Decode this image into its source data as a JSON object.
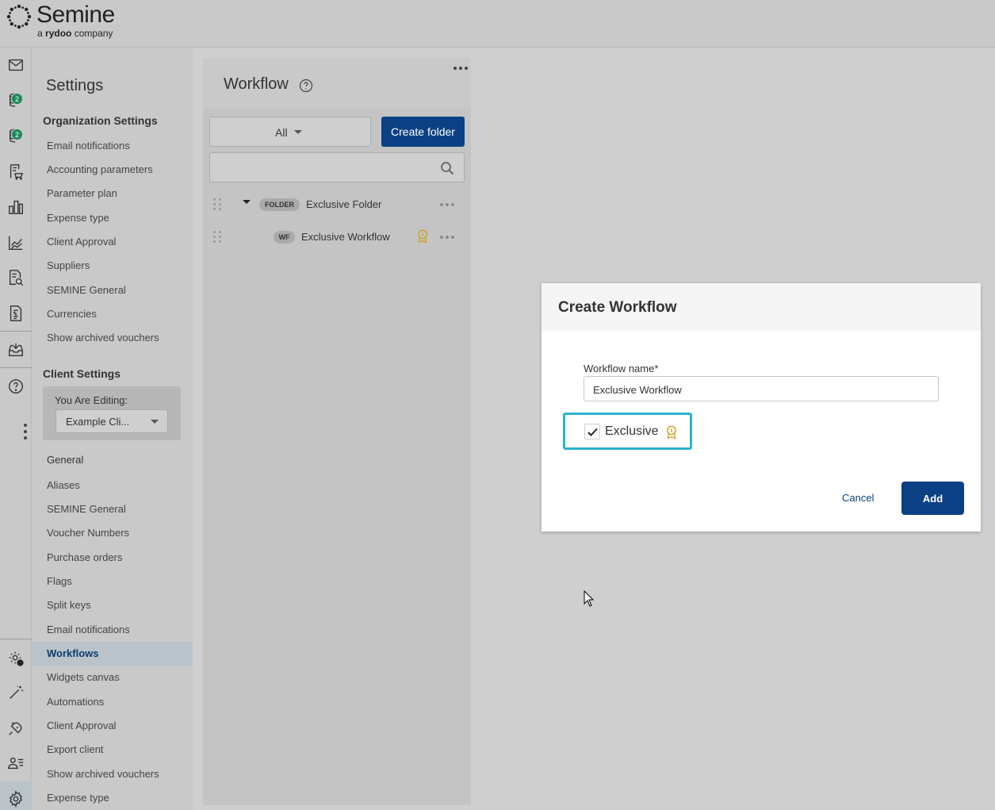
{
  "brand": {
    "name": "Semine",
    "subtitle_prefix": "a",
    "subtitle_brand": "rydoo",
    "subtitle_suffix": "company"
  },
  "rail": {
    "badges": [
      "2",
      "2"
    ]
  },
  "settings": {
    "title": "Settings",
    "org_section": "Organization Settings",
    "org_items": [
      "Email notifications",
      "Accounting parameters",
      "Parameter plan",
      "Expense type",
      "Client Approval",
      "Suppliers",
      "SEMINE General",
      "Currencies",
      "Show archived vouchers"
    ],
    "client_section": "Client Settings",
    "editing_label": "You Are Editing:",
    "editing_value": "Example Cli...",
    "general_title": "General",
    "general_items": [
      "Aliases",
      "SEMINE General",
      "Voucher Numbers",
      "Purchase orders",
      "Flags",
      "Split keys",
      "Email notifications",
      "Workflows",
      "Widgets canvas",
      "Automations",
      "Client Approval",
      "Export client",
      "Show archived vouchers",
      "Expense type"
    ]
  },
  "workflow": {
    "title": "Workflow",
    "filter_value": "All",
    "create_folder": "Create folder",
    "search_placeholder": "",
    "tree": [
      {
        "pill": "FOLDER",
        "label": "Exclusive Folder"
      },
      {
        "pill": "WF",
        "label": "Exclusive Workflow"
      }
    ]
  },
  "modal": {
    "title": "Create Workflow",
    "field_label": "Workflow name*",
    "field_value": "Exclusive Workflow",
    "exclusive_label": "Exclusive",
    "cancel": "Cancel",
    "add": "Add"
  },
  "colors": {
    "primary": "#0b4184",
    "highlight": "#2bb3cf",
    "badge": "#1c8a5b",
    "award": "#c9a227"
  }
}
